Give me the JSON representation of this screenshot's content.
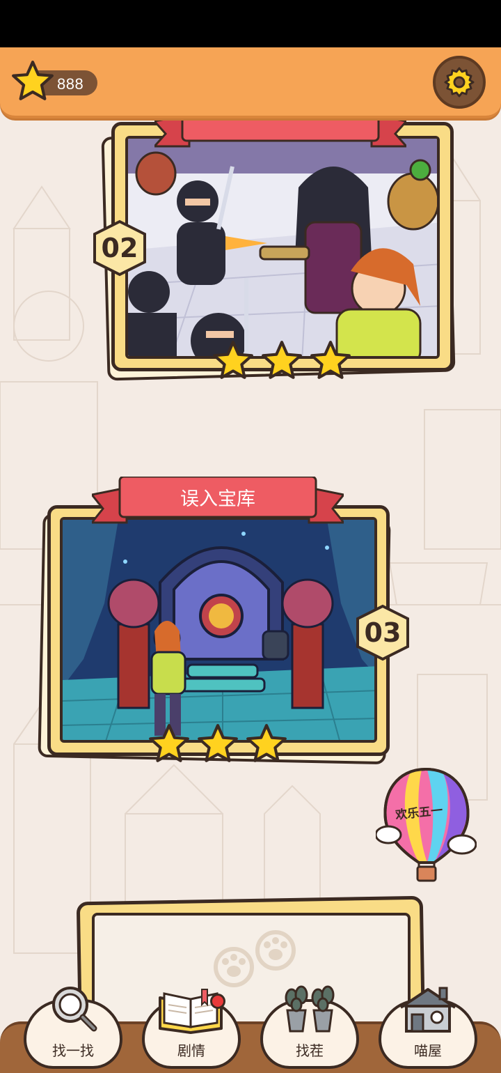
{
  "top_bar": {
    "coins": "888",
    "coin_icon": "star-icon",
    "settings_icon": "gear-icon"
  },
  "levels": [
    {
      "number": "02",
      "title": "",
      "stars_earned": 3,
      "stars_total": 3,
      "scene": "ninja-fight-scene"
    },
    {
      "number": "03",
      "title": "误入宝库",
      "stars_earned": 3,
      "stars_total": 3,
      "scene": "treasure-vault-scene"
    }
  ],
  "event_balloon": {
    "text": "欢乐五一",
    "icon": "hot-air-balloon-icon"
  },
  "locked_level": {
    "icon": "paw-print-icon"
  },
  "bottom_nav": {
    "items": [
      {
        "label": "找一找",
        "icon": "magnifier-icon"
      },
      {
        "label": "剧情",
        "icon": "book-icon",
        "has_badge": true
      },
      {
        "label": "找茬",
        "icon": "potted-plants-icon"
      },
      {
        "label": "喵屋",
        "icon": "house-icon"
      }
    ]
  },
  "colors": {
    "top_bar": "#f6a455",
    "card_frame": "#f9dc86",
    "ribbon": "#ee5c63",
    "star": "#ffd21f",
    "nav_bar": "#a0663a",
    "background": "#f4ebe4"
  }
}
